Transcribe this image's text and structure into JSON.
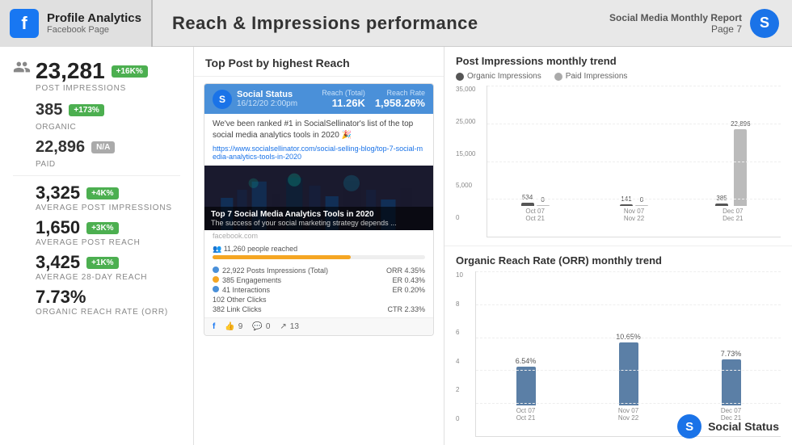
{
  "header": {
    "brand_icon": "f",
    "brand_title": "Profile Analytics",
    "brand_subtitle": "Facebook Page",
    "page_title": "Reach & Impressions  performance",
    "report_line1": "Social Media Monthly Report",
    "report_line2": "Page 7",
    "social_status_logo": "S"
  },
  "left_panel": {
    "post_impressions": {
      "value": "23,281",
      "badge": "+16K%",
      "badge_type": "green",
      "label": "POST IMPRESSIONS"
    },
    "organic": {
      "value": "385",
      "badge": "+173%",
      "badge_type": "green",
      "label": "ORGANIC"
    },
    "paid": {
      "value": "22,896",
      "badge": "N/A",
      "badge_type": "gray",
      "label": "PAID"
    },
    "avg_post_impressions": {
      "value": "3,325",
      "badge": "+4K%",
      "badge_type": "green",
      "label": "AVERAGE POST IMPRESSIONS"
    },
    "avg_post_reach": {
      "value": "1,650",
      "badge": "+3K%",
      "badge_type": "green",
      "label": "AVERAGE POST REACH"
    },
    "avg_28day_reach": {
      "value": "3,425",
      "badge": "+1K%",
      "badge_type": "green",
      "label": "AVERAGE 28-DAY REACH"
    },
    "orr": {
      "value": "7.73%",
      "label": "ORGANIC REACH RATE (ORR)"
    }
  },
  "middle_panel": {
    "title": "Top Post by highest Reach",
    "post": {
      "profile_name": "Social Status",
      "date": "16/12/20 2:00pm",
      "reach_label": "Reach (Total)",
      "reach_value": "11.26K",
      "reach_rate_label": "Reach Rate",
      "reach_rate_value": "1,958.26%",
      "body_text": "We've been ranked #1 in SocialSellinator's list of the top social media analytics tools in 2020 🎉",
      "link": "https://www.socialsellinator.com/social-selling-blog/top-7-social-media-analytics-tools-in-2020",
      "image_caption_title": "Top 7 Social Media Analytics Tools in 2020",
      "image_caption_sub": "The success of your social marketing strategy depends ...",
      "image_source": "facebook.com",
      "reach_bar_label": "11,260 people reached",
      "stats": [
        {
          "dot": "blue",
          "label": "22,922 Posts Impressions (Total)",
          "value": "ORR 4.35%"
        },
        {
          "dot": "orange",
          "label": "385 Engagements",
          "value": "ER 0.43%"
        },
        {
          "dot": "blue",
          "label": "41 Interactions",
          "value": "ER 0.20%"
        },
        {
          "label": "102 Other Clicks",
          "value": ""
        },
        {
          "label": "382 Link Clicks",
          "value": "CTR 2.33%"
        }
      ],
      "footer": {
        "fb_icon": "f",
        "likes": "9",
        "comments": "0",
        "shares": "13"
      }
    }
  },
  "right_panel": {
    "impressions_chart": {
      "title": "Post Impressions monthly trend",
      "legend": [
        {
          "label": "Organic Impressions",
          "type": "dark"
        },
        {
          "label": "Paid Impressions",
          "type": "light"
        }
      ],
      "y_labels": [
        "35,000",
        "25,000",
        "15,000",
        "5,000",
        "0"
      ],
      "groups": [
        {
          "label1": "Oct 07",
          "label2": "Oct 21",
          "organic": 534,
          "paid": 0,
          "organic_label": "534",
          "paid_label": "0"
        },
        {
          "label1": "Nov 07",
          "label2": "Nov 22",
          "organic": 141,
          "paid": 0,
          "organic_label": "141",
          "paid_label": "0"
        },
        {
          "label1": "Dec 07",
          "label2": "Dec 21",
          "organic": 385,
          "paid": 22896,
          "organic_label": "385",
          "paid_label": "22,896"
        }
      ],
      "max_value": 35000
    },
    "orr_chart": {
      "title": "Organic Reach Rate (ORR) monthly trend",
      "y_labels": [
        "10",
        "8",
        "6",
        "4",
        "2",
        "0"
      ],
      "groups": [
        {
          "label1": "Oct 07",
          "label2": "Oct 21",
          "value": 6.54,
          "label": "6.54%"
        },
        {
          "label1": "Nov 07",
          "label2": "Nov 22",
          "value": 10.65,
          "label": "10.65%"
        },
        {
          "label1": "Dec 07",
          "label2": "Dec 21",
          "value": 7.73,
          "label": "7.73%"
        }
      ],
      "max_value": 12
    }
  },
  "footer": {
    "logo": "S",
    "brand": "Social Status"
  }
}
